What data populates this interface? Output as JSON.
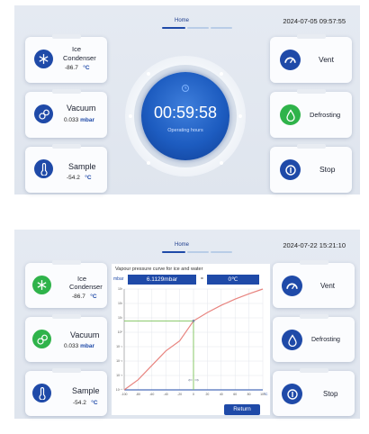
{
  "screen1": {
    "nav": {
      "title": "Home"
    },
    "datetime": "2024-07-05 09:57:55",
    "left_cards": [
      {
        "label_line1": "Ice",
        "label_line2": "Condenser",
        "value": "-86.7",
        "unit": "°C",
        "icon": "snowflake-icon"
      },
      {
        "label": "Vacuum",
        "value": "0.033",
        "unit": "mbar",
        "icon": "vacuum-icon"
      },
      {
        "label": "Sample",
        "value": "-54.2",
        "unit": "°C",
        "icon": "thermometer-icon"
      }
    ],
    "right_cards": [
      {
        "label": "Vent",
        "icon": "gauge-icon"
      },
      {
        "label": "Defrosting",
        "icon": "drop-icon"
      },
      {
        "label": "Stop",
        "icon": "stop-icon"
      }
    ],
    "dial": {
      "time": "00:59:58",
      "caption": "Operating hours",
      "icon": "clock-icon"
    }
  },
  "screen2": {
    "nav": {
      "title": "Home"
    },
    "datetime": "2024-07-22 15:21:10",
    "left_cards": [
      {
        "label_line1": "Ice",
        "label_line2": "Condenser",
        "value": "-86.7",
        "unit": "°C",
        "icon": "snowflake-icon"
      },
      {
        "label": "Vacuum",
        "value": "0.033",
        "unit": "mbar",
        "icon": "vacuum-icon"
      },
      {
        "label": "Sample",
        "value": "-54.2",
        "unit": "°C",
        "icon": "thermometer-icon"
      }
    ],
    "right_cards": [
      {
        "label": "Vent",
        "icon": "gauge-icon"
      },
      {
        "label": "Defrosting",
        "icon": "drop-icon"
      },
      {
        "label": "Stop",
        "icon": "stop-icon"
      }
    ],
    "chart_panel": {
      "title": "Vapour pressure curve for ice and water",
      "pressure_unit": "mbar",
      "pressure_readout": "6.1129mbar",
      "equals": "=",
      "temperature_readout": "0℃",
      "return_label": "Return",
      "arrows": "⇐ ⇒"
    },
    "colors": {
      "accent": "#1f4aa8",
      "green": "#2fb34a",
      "curve": "#e8847f",
      "marker": "#7cc35a"
    }
  },
  "chart_data": {
    "type": "line",
    "title": "Vapour pressure curve for ice and water",
    "xlabel": "",
    "ylabel": "",
    "x_unit": "°C",
    "y_unit": "mbar",
    "x": [
      -100,
      -80,
      -60,
      -40,
      -20,
      0,
      20,
      40,
      60,
      80,
      100
    ],
    "x_ticks": [
      "-100",
      "-80",
      "-60",
      "-40",
      "-20",
      "0",
      "20",
      "40",
      "60",
      "80",
      "100"
    ],
    "y_ticks": [
      "10⁻⁴",
      "10⁻³",
      "10⁻²",
      "10⁻¹",
      "10⁰",
      "10¹",
      "10²",
      "10³"
    ],
    "ylim_log": [
      -4,
      3
    ],
    "y_log": [
      -4.0,
      -3.3,
      -2.3,
      -1.3,
      -0.6,
      0.79,
      1.37,
      1.87,
      2.3,
      2.67,
      3.0
    ],
    "marker": {
      "x": 0,
      "y": 6.1129
    },
    "grid": true
  }
}
